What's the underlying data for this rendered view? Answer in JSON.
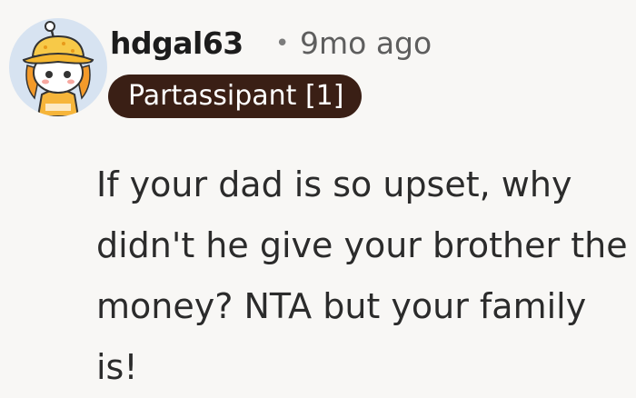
{
  "comment": {
    "author": "hdgal63",
    "separator": "•",
    "timestamp": "9mo ago",
    "flair": "Partassipant [1]",
    "avatar_icon": "snoo-avatar-yellow-bucket-hat",
    "body": "If your dad is so upset, why didn't he give your brother the money? NTA but your family is!"
  },
  "colors": {
    "background": "#f8f7f5",
    "flair_background": "#3a1f15",
    "flair_text": "#ffffff",
    "username": "#1c1c1c",
    "meta": "#5e5e5e",
    "body_text": "#2b2b2b",
    "avatar_background": "#d7e3f1"
  }
}
